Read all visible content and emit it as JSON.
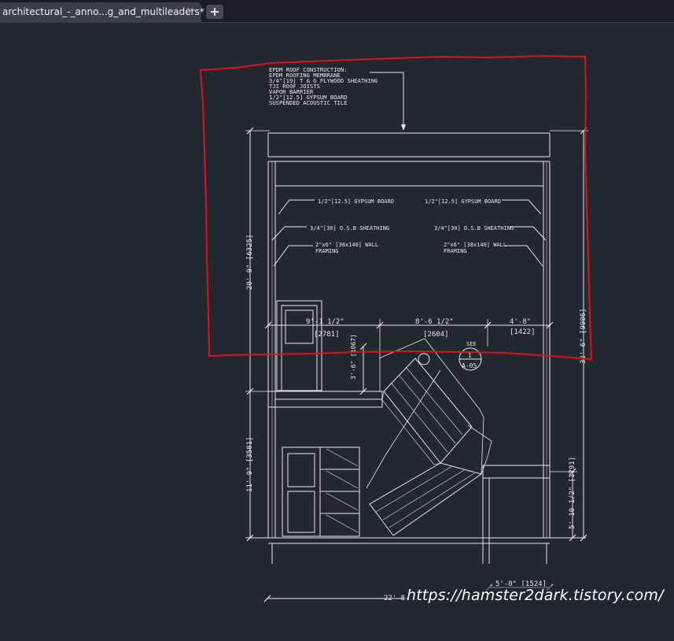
{
  "tab": {
    "title": "architectural_-_anno...g_and_multileaders*",
    "close_glyph": "✕",
    "add_icon": "plus-icon"
  },
  "colors": {
    "canvas": "#212830",
    "markup": "#e0101c",
    "linework": "#e8e8e8"
  },
  "notes": {
    "roof": [
      "EPDM ROOF CONSTRUCTION:",
      "EPDM ROOFING MEMBRANE",
      "3/4\"[19] T & G PLYWOOD SHEATHING",
      "TJI ROOF JOISTS",
      "VAPOR BARRIER",
      "1/2\"[12.5] GYPSUM BOARD",
      "SUSPENDED ACOUSTIC TILE"
    ],
    "left_gypsum": "1/2\"[12.5] GYPSUM BOARD",
    "right_gypsum": "1/2\"[12.5] GYPSUM BOARD",
    "left_sheathing": "3/4\"[30] O.S.B SHEATHING",
    "right_sheathing": "3/4\"[30] O.S.B SHEATHING",
    "left_framing": [
      "2\"x6\" [38x140] WALL",
      "FRAMING"
    ],
    "right_framing": [
      "2\"x6\" [38x140] WALL",
      "FRAMING"
    ]
  },
  "dimensions": {
    "left_upper": "20'-9\" [6325]",
    "left_lower": "11'-9\" [3581]",
    "right_total": "32'-6\" [9906]",
    "right_lower": "5'-10 1/2\" [1791]",
    "span_left": "9'-1 1/2\"",
    "span_left_mm": "[2781]",
    "span_center": "8'-6 1/2\"",
    "span_center_mm": "[2604]",
    "span_right": "4'-8\"",
    "span_right_mm": "[1422]",
    "door_height": "3'-6\" [1067]",
    "bottom_right": "5'-0\" [1524]",
    "bottom_total": "22'-8"
  },
  "callout": {
    "see": "SEE",
    "number": "1",
    "sheet": "A-05"
  },
  "watermark": "https://hamster2dark.tistory.com/"
}
